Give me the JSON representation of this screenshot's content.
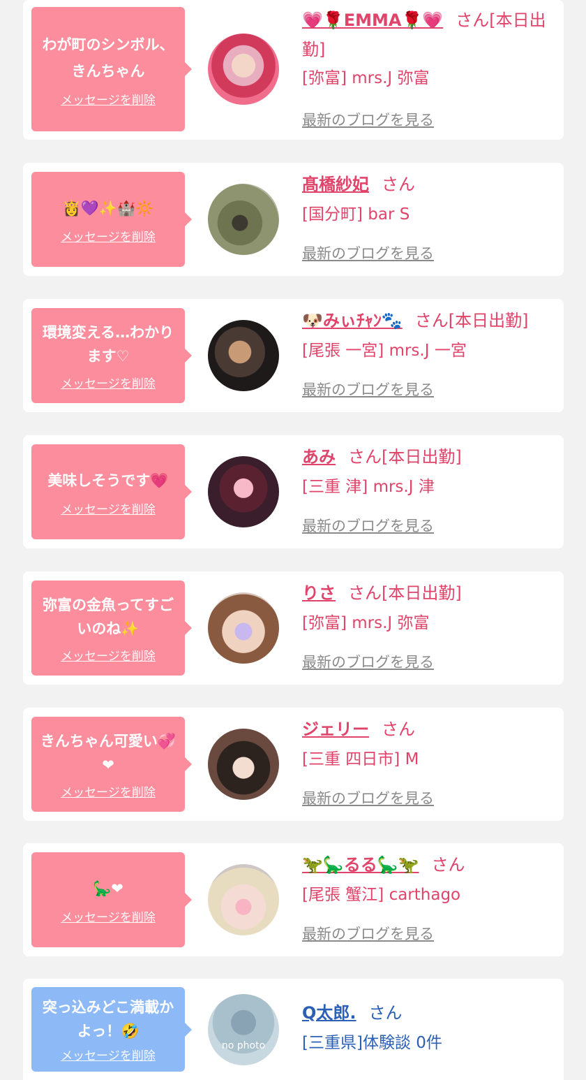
{
  "delete_label": "メッセージを削除",
  "blog_label": "最新のブログを見る",
  "san_label": "さん",
  "cards": [
    {
      "message": "わが町のシンボル、きんちゃん",
      "name": "💗🌹EMMA🌹💗",
      "status": "[本日出勤]",
      "shop": "[弥富] mrs.J 弥富"
    },
    {
      "message": "👸💜✨🏰🔆",
      "name": "髙橋紗妃",
      "status": "",
      "shop": "[国分町] bar S"
    },
    {
      "message": "環境変える…わかります♡",
      "name": "🐶みぃﾁｬﾝ🐾",
      "status": "[本日出勤]",
      "shop": "[尾張 一宮] mrs.J 一宮"
    },
    {
      "message": "美味しそうです💗",
      "name": "あみ",
      "status": "[本日出勤]",
      "shop": "[三重 津] mrs.J 津"
    },
    {
      "message": "弥富の金魚ってすごいのね✨",
      "name": "りさ",
      "status": "[本日出勤]",
      "shop": "[弥富] mrs.J 弥富"
    },
    {
      "message": "きんちゃん可愛い💞❤",
      "name": "ジェリー",
      "status": "",
      "shop": "[三重 四日市] M"
    },
    {
      "message": "🦕❤",
      "name": "🦖🦕るる🦕🦖",
      "status": "",
      "shop": "[尾張 蟹江] carthago"
    },
    {
      "message": "突っ込みどこ満載かよっ！🤣",
      "name": "Q太郎.",
      "status": "",
      "shop": "[三重県]体験談 0件",
      "avatar_text": "no photo"
    }
  ],
  "colors": {
    "pink": "#fc8d9c",
    "blue": "#8dbaf7",
    "name_pink": "#e0446a",
    "name_blue": "#2c5fb6",
    "link_gray": "#8a8a8a"
  }
}
